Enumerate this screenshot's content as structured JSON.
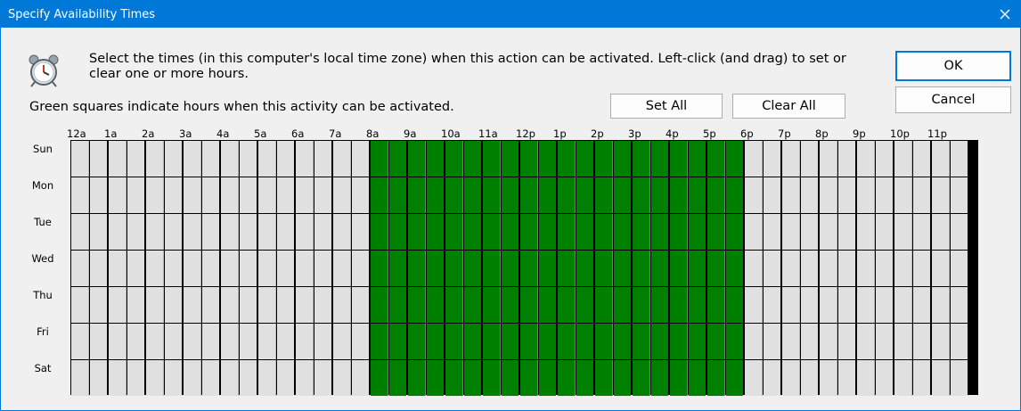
{
  "window": {
    "title": "Specify Availability Times"
  },
  "icons": {
    "close": "close-icon",
    "clock": "alarm-clock-icon"
  },
  "instructions": "Select the times (in this computer's local time zone) when this action can be activated.  Left-click (and drag) to set or clear one or more hours.",
  "legend": "Green squares indicate hours when this activity can be activated.",
  "buttons": {
    "ok": "OK",
    "cancel": "Cancel",
    "set_all": "Set All",
    "clear_all": "Clear All"
  },
  "hours": [
    "12a",
    "1a",
    "2a",
    "3a",
    "4a",
    "5a",
    "6a",
    "7a",
    "8a",
    "9a",
    "10a",
    "11a",
    "12p",
    "1p",
    "2p",
    "3p",
    "4p",
    "5p",
    "6p",
    "7p",
    "8p",
    "9p",
    "10p",
    "11p"
  ],
  "days": [
    "Sun",
    "Mon",
    "Tue",
    "Wed",
    "Thu",
    "Fri",
    "Sat"
  ],
  "grid": {
    "subdivisions_per_hour": 2,
    "active_from_hour": 8,
    "active_to_hour": 18
  },
  "colors": {
    "active": "#008000",
    "inactive": "#e0e0e0",
    "titlebar": "#0078d7"
  }
}
